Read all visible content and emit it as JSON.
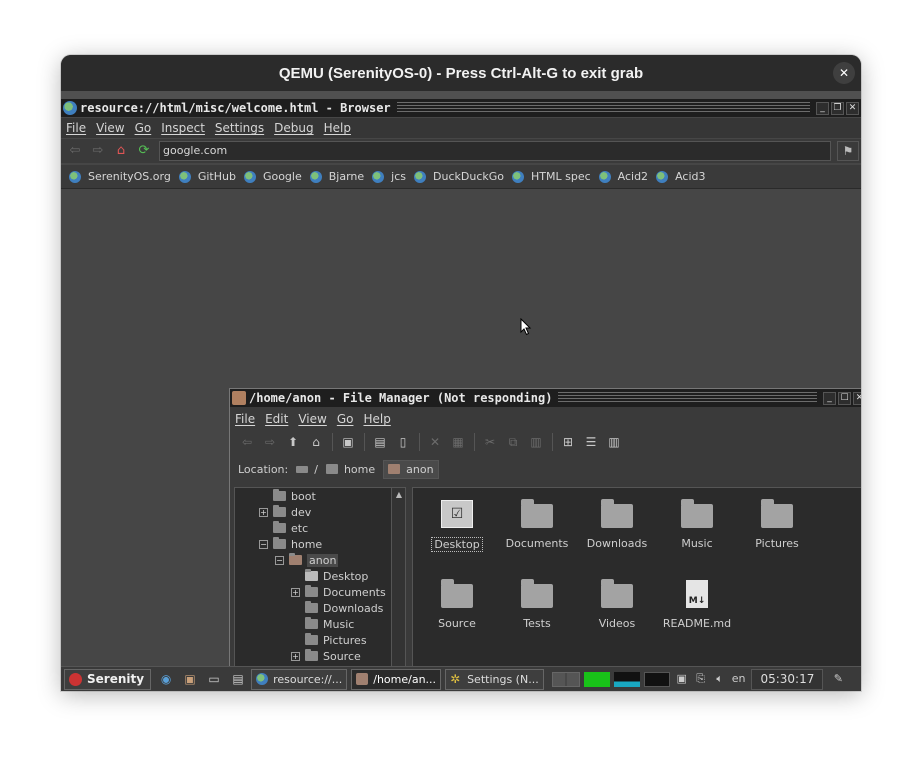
{
  "host": {
    "title": "QEMU (SerenityOS-0) - Press Ctrl-Alt-G to exit grab",
    "close_glyph": "✕"
  },
  "browser": {
    "title": "resource://html/misc/welcome.html - Browser",
    "menu": [
      "File",
      "View",
      "Go",
      "Inspect",
      "Settings",
      "Debug",
      "Help"
    ],
    "url": "google.com",
    "bookmarks": [
      "SerenityOS.org",
      "GitHub",
      "Google",
      "Bjarne",
      "jcs",
      "DuckDuckGo",
      "HTML spec",
      "Acid2",
      "Acid3"
    ]
  },
  "file_manager": {
    "title": "/home/anon - File Manager (Not responding)",
    "menu": [
      "File",
      "Edit",
      "View",
      "Go",
      "Help"
    ],
    "location_label": "Location:",
    "breadcrumbs": [
      "/",
      "home",
      "anon"
    ],
    "tree": [
      {
        "label": "boot",
        "expander": ""
      },
      {
        "label": "dev",
        "expander": "+"
      },
      {
        "label": "etc",
        "expander": ""
      },
      {
        "label": "home",
        "expander": "−"
      },
      {
        "label": "anon",
        "expander": "−"
      },
      {
        "label": "Desktop",
        "expander": ""
      },
      {
        "label": "Documents",
        "expander": "+"
      },
      {
        "label": "Downloads",
        "expander": ""
      },
      {
        "label": "Music",
        "expander": ""
      },
      {
        "label": "Pictures",
        "expander": ""
      },
      {
        "label": "Source",
        "expander": "+"
      }
    ],
    "items": [
      "Desktop",
      "Documents",
      "Downloads",
      "Music",
      "Pictures",
      "Source",
      "Tests",
      "Videos",
      "README.md"
    ],
    "readme_badge": "M↓"
  },
  "taskbar": {
    "start_label": "Serenity",
    "tasks": [
      "resource://...",
      "/home/an...",
      "Settings (N..."
    ],
    "keyboard_layout": "en",
    "clock": "05:30:17"
  },
  "colors": {
    "cpu_graph": "#19c219",
    "net_graph": "#19a8c2",
    "start_logo": "#cc3333"
  }
}
